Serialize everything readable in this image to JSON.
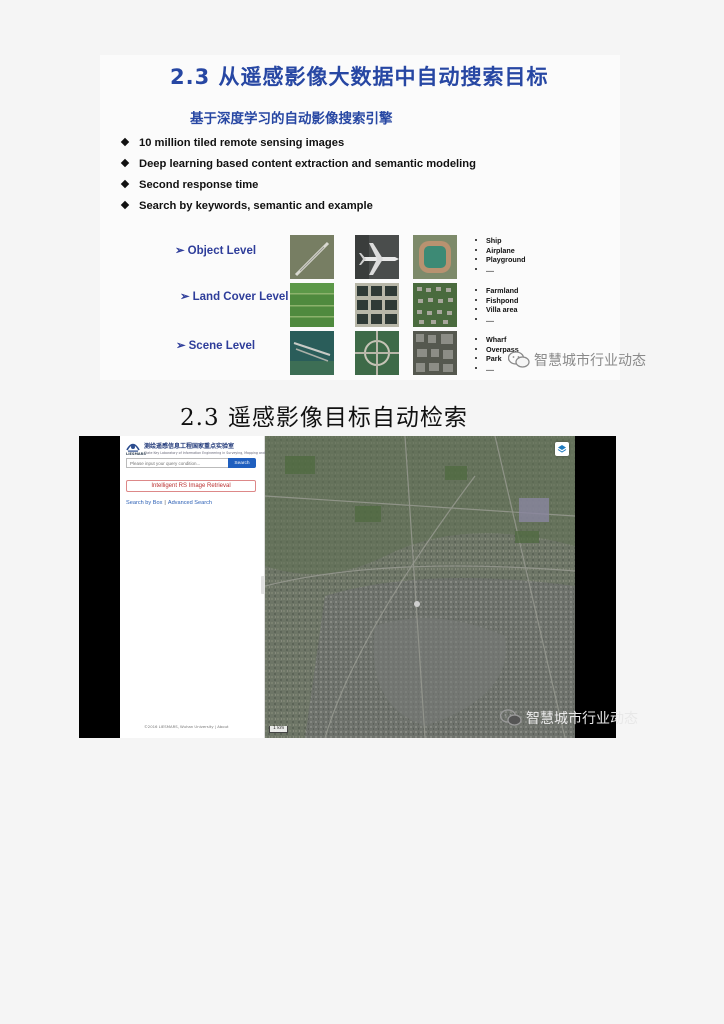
{
  "slide": {
    "title": "2.3 从遥感影像大数据中自动搜索目标",
    "subtitle": "基于深度学习的自动影像搜索引擎",
    "bullets": [
      "10 million tiled remote sensing images",
      "Deep learning based content extraction and semantic modeling",
      "Second response time",
      "Search by keywords, semantic and example"
    ],
    "levels": [
      {
        "label": "Object Level",
        "items": [
          "Ship",
          "Airplane",
          "Playground",
          "...."
        ]
      },
      {
        "label": "Land Cover Level",
        "items": [
          "Farmland",
          "Fishpond",
          "Villa area",
          "...."
        ]
      },
      {
        "label": "Scene Level",
        "items": [
          "Wharf",
          "Overpass",
          "Park",
          "...."
        ]
      }
    ]
  },
  "watermark": {
    "text": "智慧城市行业动态"
  },
  "section2": {
    "title": "2.3 遥感影像目标自动检索"
  },
  "app": {
    "logo_title": "测绘遥感信息工程国家重点实验室",
    "logo_subtitle": "State Key Laboratory of Information Engineering in Surveying, Mapping and Remote Sensing",
    "logo_caption": "LIESMARS",
    "search_placeholder": "Please input your query condition...",
    "search_button": "Search",
    "panel_title": "Intelligent  RS  Image  Retrieval",
    "link_box": "Search by Box",
    "link_sep": "|",
    "link_advanced": "Advanced Search",
    "copyright": "©2016 LIESMARS, Wuhan University | About",
    "scale_label": "1 km"
  },
  "colors": {
    "slide_blue": "#2747a3",
    "level_blue": "#2e3d9a",
    "search_blue": "#1f5fbf",
    "link_blue": "#2b5fb5"
  }
}
